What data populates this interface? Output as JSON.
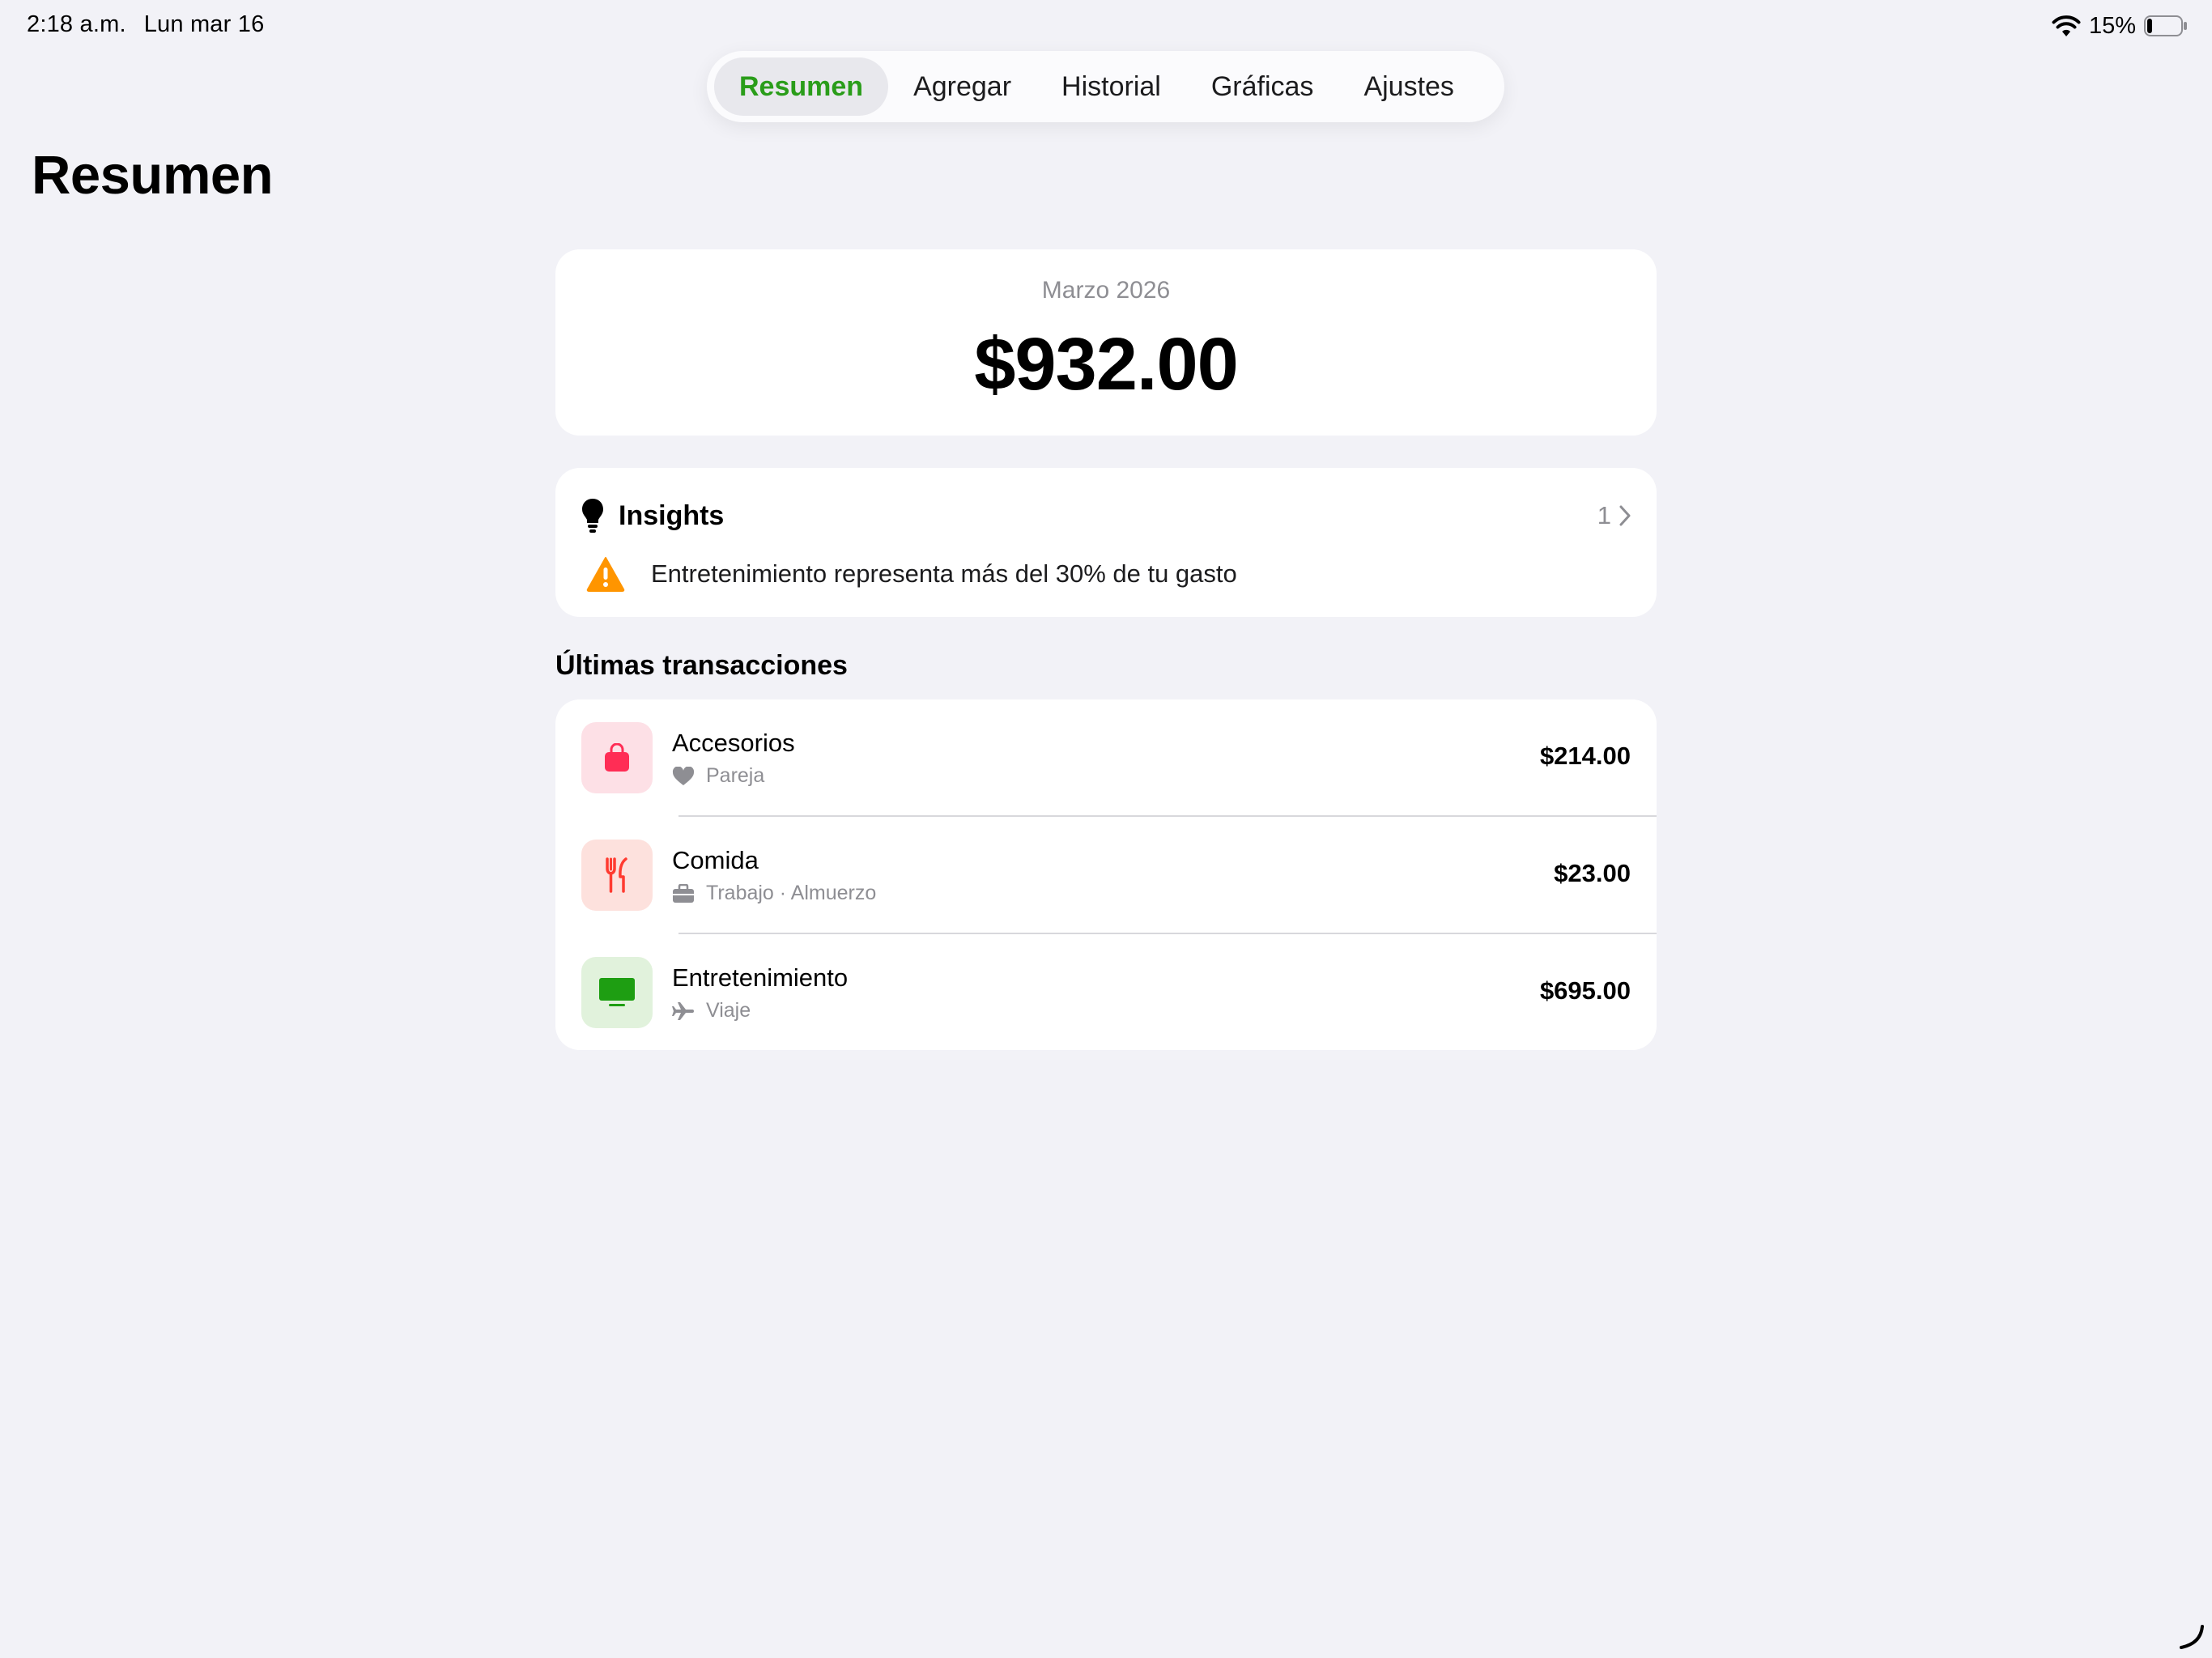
{
  "status_bar": {
    "time": "2:18 a.m.",
    "date": "Lun mar 16",
    "battery": "15%",
    "icons": [
      "wifi-icon",
      "battery-icon"
    ]
  },
  "tabs": [
    {
      "label": "Resumen",
      "active": true
    },
    {
      "label": "Agregar",
      "active": false
    },
    {
      "label": "Historial",
      "active": false
    },
    {
      "label": "Gráficas",
      "active": false
    },
    {
      "label": "Ajustes",
      "active": false
    }
  ],
  "page_title": "Resumen",
  "summary": {
    "month": "Marzo 2026",
    "total": "$932.00"
  },
  "insights": {
    "title": "Insights",
    "count": "1",
    "items": [
      {
        "icon": "warning-icon",
        "text": "Entretenimiento representa más del 30% de tu gasto"
      }
    ]
  },
  "transactions": {
    "title": "Últimas transacciones",
    "items": [
      {
        "category": "Accesorios",
        "icon": "shopping-bag-icon",
        "sub_icon": "heart-icon",
        "detail": "Pareja",
        "amount": "$214.00"
      },
      {
        "category": "Comida",
        "icon": "fork-knife-icon",
        "sub_icon": "briefcase-icon",
        "detail": "Trabajo · Almuerzo",
        "amount": "$23.00"
      },
      {
        "category": "Entretenimiento",
        "icon": "tv-icon",
        "sub_icon": "airplane-icon",
        "detail": "Viaje",
        "amount": "$695.00"
      }
    ]
  },
  "colors": {
    "background": "#f2f2f7",
    "accent_green": "#2a9d1a",
    "accesorios": "#ff2d55",
    "comida": "#ff3b30",
    "entretenimiento": "#1e9e12",
    "warning": "#ff9500"
  }
}
